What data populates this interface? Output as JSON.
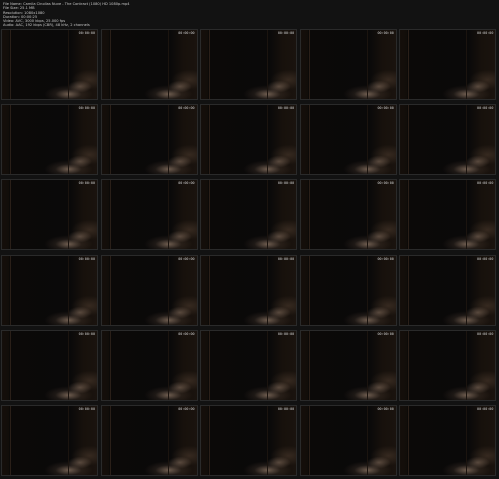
{
  "header": {
    "file_name": "File Name: Camila Cinolias Nuve - The Contract (1080) HD 1080p.mp4",
    "file_size": "File Size: 25.1 MB",
    "resolution": "Resolution: 1080x1080",
    "duration": "Duration: 00:00:25",
    "video": "Video: AVC, 3000 kbps, 25.000 fps",
    "audio": "Audio: AAC, 192 kbps (CBR), 48 kHz, 2 channels"
  },
  "thumbnails": [
    {
      "timestamp": "00:00:00"
    },
    {
      "timestamp": "00:00:00"
    },
    {
      "timestamp": "00:00:00"
    },
    {
      "timestamp": "00:00:00"
    },
    {
      "timestamp": "00:00:00"
    },
    {
      "timestamp": "00:00:00"
    },
    {
      "timestamp": "00:00:00"
    },
    {
      "timestamp": "00:00:00"
    },
    {
      "timestamp": "00:00:00"
    },
    {
      "timestamp": "00:00:00"
    },
    {
      "timestamp": "00:00:00"
    },
    {
      "timestamp": "00:00:00"
    },
    {
      "timestamp": "00:00:00"
    },
    {
      "timestamp": "00:00:00"
    },
    {
      "timestamp": "00:00:00"
    },
    {
      "timestamp": "00:00:00"
    },
    {
      "timestamp": "00:00:00"
    },
    {
      "timestamp": "00:00:00"
    },
    {
      "timestamp": "00:00:00"
    },
    {
      "timestamp": "00:00:00"
    },
    {
      "timestamp": "00:00:00"
    },
    {
      "timestamp": "00:00:00"
    },
    {
      "timestamp": "00:00:00"
    },
    {
      "timestamp": "00:00:00"
    },
    {
      "timestamp": "00:00:00"
    },
    {
      "timestamp": "00:00:00"
    },
    {
      "timestamp": "00:00:00"
    },
    {
      "timestamp": "00:00:00"
    },
    {
      "timestamp": "00:00:00"
    },
    {
      "timestamp": "00:00:00"
    }
  ]
}
